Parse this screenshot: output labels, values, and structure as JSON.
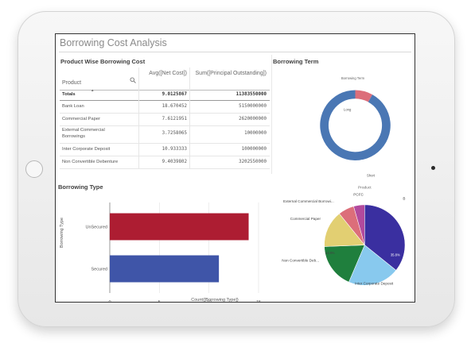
{
  "dashboard": {
    "title": "Borrowing Cost Analysis"
  },
  "table": {
    "title": "Product Wise Borrowing Cost",
    "columns": {
      "product": "Product",
      "avg": "Avg([Net Cost])",
      "sum": "Sum([Principal Outstanding])"
    },
    "sort_indicator": "▲",
    "totals": {
      "label": "Totals",
      "avg": "9.0125867",
      "sum": "11383550000"
    },
    "rows": [
      {
        "product": "Bank Loan",
        "avg": "18.670452",
        "sum": "5150000000"
      },
      {
        "product": "Commercial Paper",
        "avg": "7.6121951",
        "sum": "2620000000"
      },
      {
        "product": "External Commercial Borrowings",
        "avg": "3.7258065",
        "sum": "10000000"
      },
      {
        "product": "Inter Corporate Deposit",
        "avg": "10.933333",
        "sum": "100000000"
      },
      {
        "product": "Non Convertible Debenture",
        "avg": "9.4039802",
        "sum": "3202550000"
      }
    ]
  },
  "borrowing_term": {
    "title": "Borrowing Term",
    "subtitle": "Borrowing Term",
    "slice_labels": {
      "long": "Long",
      "short": "Short",
      "long_pct": "8%",
      "short_pct": "91%"
    }
  },
  "borrowing_type": {
    "title": "Borrowing Type",
    "y_axis_label": "Borrowing Type",
    "x_axis_label": "Count([Borrowing Type])",
    "ticks": [
      "0",
      "5",
      "10",
      "15"
    ]
  },
  "product_pie": {
    "title": "Product",
    "labels": {
      "ecb": "External Commercial Borrowi...",
      "pcfc": "PCFC",
      "cp": "Commercial Paper",
      "ncd": "Non Convertible Deb...",
      "icd": "Inter Corporate Deposit",
      "bl": "B"
    },
    "pcts": {
      "bl": "35.8%",
      "cp": "14.8%",
      "ncd": "18%",
      "icd": "20.6%"
    }
  },
  "chart_data": [
    {
      "type": "pie",
      "title": "Borrowing Term",
      "categories": [
        "Long",
        "Short"
      ],
      "values": [
        8,
        91
      ],
      "colors": [
        "#dc6e7a",
        "#4a77b4"
      ],
      "donut": true
    },
    {
      "type": "bar",
      "title": "Borrowing Type",
      "orientation": "horizontal",
      "categories": [
        "UnSecured",
        "Secured"
      ],
      "values": [
        14,
        11
      ],
      "colors": [
        "#ad1d32",
        "#3f55a8"
      ],
      "xlabel": "Count([Borrowing Type])",
      "ylabel": "Borrowing Type",
      "xlim": [
        0,
        15
      ],
      "grid": true
    },
    {
      "type": "pie",
      "title": "Product",
      "categories": [
        "Bank Loan",
        "Inter Corporate Deposit",
        "Non Convertible Debenture",
        "Commercial Paper",
        "External Commercial Borrowings",
        "PCFC"
      ],
      "values": [
        35.8,
        20.6,
        18,
        14.8,
        6.4,
        4.4
      ],
      "colors": [
        "#3a2fa0",
        "#88c9ee",
        "#1f7f3d",
        "#e2cf72",
        "#dc6e7a",
        "#b24a9d"
      ]
    }
  ]
}
